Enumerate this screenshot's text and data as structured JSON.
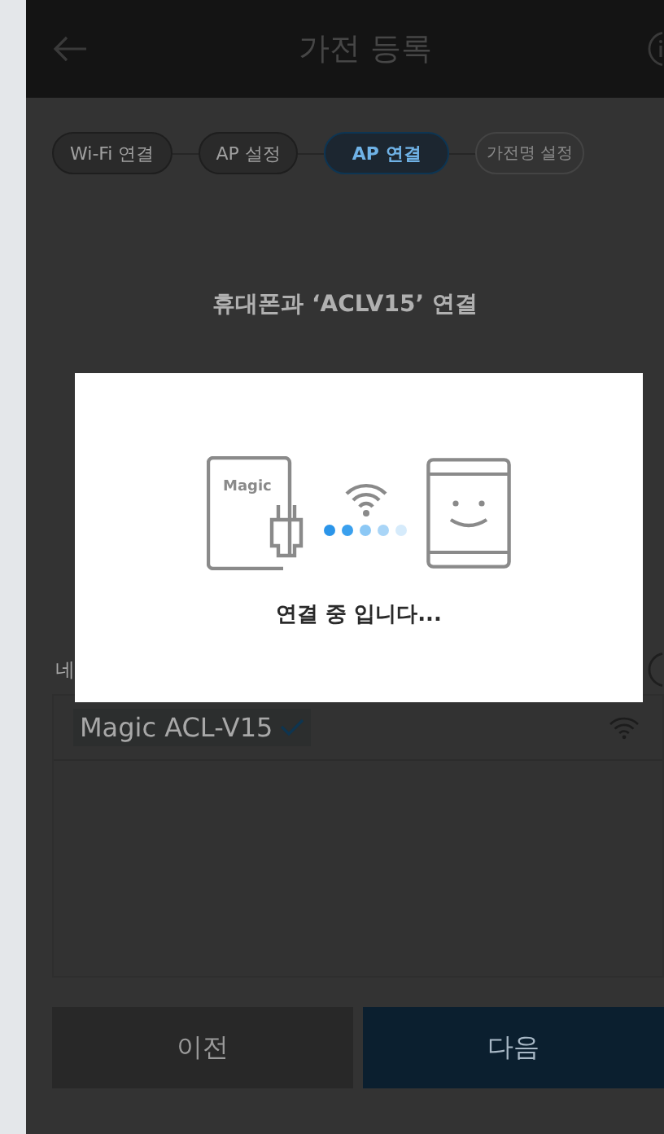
{
  "header": {
    "title": "가전 등록"
  },
  "steps": [
    {
      "label": "Wi-Fi 연결",
      "selected": false,
      "disabled": false
    },
    {
      "label": "AP 설정",
      "selected": false,
      "disabled": false
    },
    {
      "label": "AP 연결",
      "selected": true,
      "disabled": false
    },
    {
      "label": "가전명 설정",
      "selected": false,
      "disabled": true
    }
  ],
  "heading": "휴대폰과 ‘ACLV15’ 연결",
  "network_label": "네",
  "networks": [
    {
      "name": "Magic ACL-V15",
      "selected": true
    }
  ],
  "buttons": [
    {
      "label": "이전",
      "kind": "secondary"
    },
    {
      "label": "다음",
      "kind": "primary"
    }
  ],
  "dialog": {
    "device_logo": "Magic",
    "dots": [
      {
        "color": "#2b95e9"
      },
      {
        "color": "#3aa0ee"
      },
      {
        "color": "#8cc8f5"
      },
      {
        "color": "#a9d5f7"
      },
      {
        "color": "#d6ebfb"
      }
    ],
    "message": "연결 중 입니다..."
  }
}
